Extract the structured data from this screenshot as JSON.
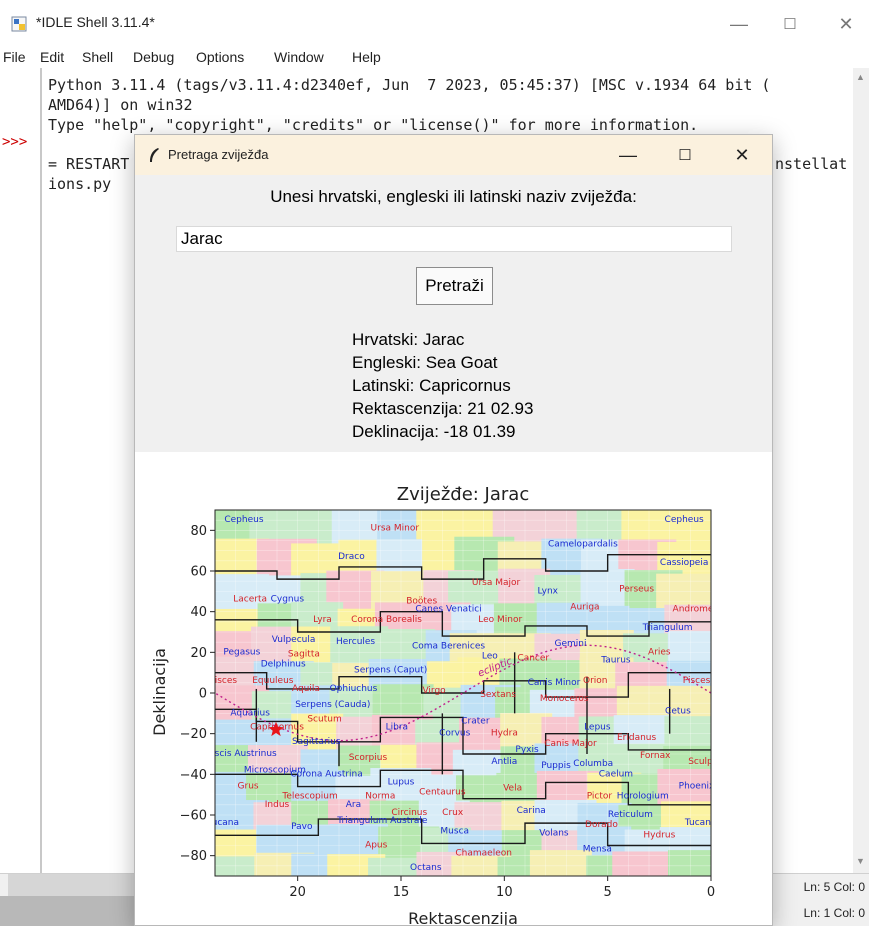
{
  "idle": {
    "title": "*IDLE Shell 3.11.4*",
    "window_controls": {
      "minimize": "—",
      "maximize": "☐",
      "close": "✕"
    },
    "menu": [
      "File",
      "Edit",
      "Shell",
      "Debug",
      "Options",
      "Window",
      "Help"
    ],
    "prompt": ">>>",
    "lines": [
      "Python 3.11.4 (tags/v3.11.4:d2340ef, Jun  7 2023, 05:45:37) [MSC v.1934 64 bit (",
      "AMD64)] on win32",
      "Type \"help\", \"copyright\", \"credits\" or \"license()\" for more information.",
      "",
      "= RESTART",
      "ions.py"
    ],
    "restart_tail": "nstellat",
    "status": {
      "top": "Ln: 5  Col: 0",
      "bottom": "Ln: 1  Col: 0"
    }
  },
  "dialog": {
    "title": "Pretraga zviježđa",
    "controls": {
      "minimize": "—",
      "maximize": "☐",
      "close": "✕"
    },
    "prompt_label": "Unesi hrvatski, engleski ili latinski naziv zviježđa:",
    "search": {
      "value": "Jarac",
      "placeholder": ""
    },
    "search_button": "Pretraži",
    "result": {
      "hr": "Hrvatski: Jarac",
      "en": "Engleski: Sea Goat",
      "la": "Latinski: Capricornus",
      "ra": "Rektascenzija: 21 02.93",
      "dec": "Deklinacija: -18 01.39"
    }
  },
  "chart_data": {
    "type": "scatter",
    "title": "Zviježđe: Jarac",
    "xlabel": "Rektascenzija",
    "ylabel": "Deklinacija",
    "xlim": [
      24,
      0
    ],
    "ylim": [
      -90,
      90
    ],
    "xticks": [
      20,
      15,
      10,
      5,
      0
    ],
    "yticks": [
      80,
      60,
      40,
      20,
      0,
      -20,
      -40,
      -60,
      -80
    ],
    "grid": true,
    "highlight": {
      "name": "Capricornus",
      "x": 21.05,
      "y": -18.02,
      "color": "#e8151b",
      "marker": "star"
    },
    "ecliptic_label": "ecliptic",
    "constellations": [
      {
        "name": "Cepheus",
        "x": 22.6,
        "y": 84,
        "color": "blue"
      },
      {
        "name": "Cepheus",
        "x": 1.3,
        "y": 84,
        "color": "blue"
      },
      {
        "name": "Ursa Minor",
        "x": 15.3,
        "y": 80,
        "color": "red"
      },
      {
        "name": "Draco",
        "x": 17.4,
        "y": 66,
        "color": "blue"
      },
      {
        "name": "Camelopardalis",
        "x": 6.2,
        "y": 72,
        "color": "blue"
      },
      {
        "name": "Cassiopeia",
        "x": 1.3,
        "y": 63,
        "color": "blue"
      },
      {
        "name": "Ursa Major",
        "x": 10.4,
        "y": 53,
        "color": "red"
      },
      {
        "name": "Lacerta",
        "x": 22.3,
        "y": 45,
        "color": "red"
      },
      {
        "name": "Cygnus",
        "x": 20.5,
        "y": 45,
        "color": "blue"
      },
      {
        "name": "Boötes",
        "x": 14.0,
        "y": 44,
        "color": "red"
      },
      {
        "name": "Canes Venatici",
        "x": 12.7,
        "y": 40,
        "color": "blue"
      },
      {
        "name": "Lynx",
        "x": 7.9,
        "y": 49,
        "color": "blue"
      },
      {
        "name": "Perseus",
        "x": 3.6,
        "y": 50,
        "color": "red"
      },
      {
        "name": "Auriga",
        "x": 6.1,
        "y": 41,
        "color": "red"
      },
      {
        "name": "Andromeda",
        "x": 0.6,
        "y": 40,
        "color": "red"
      },
      {
        "name": "Lyra",
        "x": 18.8,
        "y": 35,
        "color": "red"
      },
      {
        "name": "Corona Borealis",
        "x": 15.7,
        "y": 35,
        "color": "red"
      },
      {
        "name": "Leo Minor",
        "x": 10.2,
        "y": 35,
        "color": "red"
      },
      {
        "name": "Triangulum",
        "x": 2.1,
        "y": 31,
        "color": "blue"
      },
      {
        "name": "Vulpecula",
        "x": 20.2,
        "y": 25,
        "color": "blue"
      },
      {
        "name": "Hercules",
        "x": 17.2,
        "y": 24,
        "color": "blue"
      },
      {
        "name": "Coma Berenices",
        "x": 12.7,
        "y": 22,
        "color": "blue"
      },
      {
        "name": "Gemini",
        "x": 6.8,
        "y": 23,
        "color": "blue"
      },
      {
        "name": "Pegasus",
        "x": 22.7,
        "y": 19,
        "color": "blue"
      },
      {
        "name": "Sagitta",
        "x": 19.7,
        "y": 18,
        "color": "red"
      },
      {
        "name": "Aries",
        "x": 2.5,
        "y": 19,
        "color": "red"
      },
      {
        "name": "Delphinus",
        "x": 20.7,
        "y": 13,
        "color": "blue"
      },
      {
        "name": "Serpens (Caput)",
        "x": 15.5,
        "y": 10,
        "color": "blue"
      },
      {
        "name": "Leo",
        "x": 10.7,
        "y": 17,
        "color": "blue"
      },
      {
        "name": "Cancer",
        "x": 8.6,
        "y": 16,
        "color": "red"
      },
      {
        "name": "Taurus",
        "x": 4.6,
        "y": 15,
        "color": "blue"
      },
      {
        "name": "Pisces",
        "x": 23.6,
        "y": 5,
        "color": "red"
      },
      {
        "name": "Equuleus",
        "x": 21.2,
        "y": 5,
        "color": "red"
      },
      {
        "name": "Aquila",
        "x": 19.6,
        "y": 1,
        "color": "red"
      },
      {
        "name": "Ophiuchus",
        "x": 17.3,
        "y": 1,
        "color": "blue"
      },
      {
        "name": "Canis Minor",
        "x": 7.6,
        "y": 4,
        "color": "blue"
      },
      {
        "name": "Orion",
        "x": 5.6,
        "y": 5,
        "color": "red"
      },
      {
        "name": "Pisces",
        "x": 0.7,
        "y": 5,
        "color": "red"
      },
      {
        "name": "Virgo",
        "x": 13.4,
        "y": 0,
        "color": "red"
      },
      {
        "name": "Sextans",
        "x": 10.3,
        "y": -2,
        "color": "red"
      },
      {
        "name": "Serpens (Cauda)",
        "x": 18.3,
        "y": -7,
        "color": "blue"
      },
      {
        "name": "Aquarius",
        "x": 22.3,
        "y": -11,
        "color": "blue"
      },
      {
        "name": "Monoceros",
        "x": 7.1,
        "y": -4,
        "color": "red"
      },
      {
        "name": "Cetus",
        "x": 1.6,
        "y": -10,
        "color": "blue"
      },
      {
        "name": "Scutum",
        "x": 18.7,
        "y": -14,
        "color": "red"
      },
      {
        "name": "Libra",
        "x": 15.2,
        "y": -18,
        "color": "blue"
      },
      {
        "name": "Capricornus",
        "x": 21.0,
        "y": -18,
        "color": "red"
      },
      {
        "name": "Crater",
        "x": 11.4,
        "y": -15,
        "color": "blue"
      },
      {
        "name": "Lepus",
        "x": 5.5,
        "y": -18,
        "color": "blue"
      },
      {
        "name": "Corvus",
        "x": 12.4,
        "y": -21,
        "color": "blue"
      },
      {
        "name": "Hydra",
        "x": 10.0,
        "y": -21,
        "color": "red"
      },
      {
        "name": "Eridanus",
        "x": 3.6,
        "y": -23,
        "color": "red"
      },
      {
        "name": "Sagittarius",
        "x": 19.1,
        "y": -25,
        "color": "blue"
      },
      {
        "name": "Canis Major",
        "x": 6.8,
        "y": -26,
        "color": "red"
      },
      {
        "name": "Pyxis",
        "x": 8.9,
        "y": -29,
        "color": "blue"
      },
      {
        "name": "Piscis Austrinus",
        "x": 22.7,
        "y": -31,
        "color": "blue"
      },
      {
        "name": "Scorpius",
        "x": 16.6,
        "y": -33,
        "color": "red"
      },
      {
        "name": "Antlia",
        "x": 10.0,
        "y": -35,
        "color": "blue"
      },
      {
        "name": "Puppis",
        "x": 7.5,
        "y": -37,
        "color": "blue"
      },
      {
        "name": "Columba",
        "x": 5.7,
        "y": -36,
        "color": "blue"
      },
      {
        "name": "Fornax",
        "x": 2.7,
        "y": -32,
        "color": "red"
      },
      {
        "name": "Sculptor",
        "x": 0.2,
        "y": -35,
        "color": "red"
      },
      {
        "name": "Microscopium",
        "x": 21.1,
        "y": -39,
        "color": "blue"
      },
      {
        "name": "Corona Austrina",
        "x": 18.6,
        "y": -41,
        "color": "blue"
      },
      {
        "name": "Caelum",
        "x": 4.6,
        "y": -41,
        "color": "blue"
      },
      {
        "name": "Lupus",
        "x": 15.0,
        "y": -45,
        "color": "blue"
      },
      {
        "name": "Grus",
        "x": 22.4,
        "y": -47,
        "color": "red"
      },
      {
        "name": "Centaurus",
        "x": 13.0,
        "y": -50,
        "color": "red"
      },
      {
        "name": "Vela",
        "x": 9.6,
        "y": -48,
        "color": "red"
      },
      {
        "name": "Phoenix",
        "x": 0.7,
        "y": -47,
        "color": "blue"
      },
      {
        "name": "Telescopium",
        "x": 19.4,
        "y": -52,
        "color": "red"
      },
      {
        "name": "Norma",
        "x": 16.0,
        "y": -52,
        "color": "red"
      },
      {
        "name": "Pictor",
        "x": 5.4,
        "y": -52,
        "color": "red"
      },
      {
        "name": "Horologium",
        "x": 3.3,
        "y": -52,
        "color": "blue"
      },
      {
        "name": "Indus",
        "x": 21.0,
        "y": -56,
        "color": "red"
      },
      {
        "name": "Ara",
        "x": 17.3,
        "y": -56,
        "color": "blue"
      },
      {
        "name": "Circinus",
        "x": 14.6,
        "y": -60,
        "color": "red"
      },
      {
        "name": "Crux",
        "x": 12.5,
        "y": -60,
        "color": "red"
      },
      {
        "name": "Carina",
        "x": 8.7,
        "y": -59,
        "color": "blue"
      },
      {
        "name": "Reticulum",
        "x": 3.9,
        "y": -61,
        "color": "blue"
      },
      {
        "name": "Triangulum Australe",
        "x": 15.9,
        "y": -64,
        "color": "blue"
      },
      {
        "name": "Tucana",
        "x": 23.6,
        "y": -65,
        "color": "blue"
      },
      {
        "name": "Pavo",
        "x": 19.8,
        "y": -67,
        "color": "blue"
      },
      {
        "name": "Musca",
        "x": 12.4,
        "y": -69,
        "color": "blue"
      },
      {
        "name": "Volans",
        "x": 7.6,
        "y": -70,
        "color": "blue"
      },
      {
        "name": "Dorado",
        "x": 5.3,
        "y": -66,
        "color": "red"
      },
      {
        "name": "Tucana",
        "x": 0.5,
        "y": -65,
        "color": "blue"
      },
      {
        "name": "Hydrus",
        "x": 2.5,
        "y": -71,
        "color": "red"
      },
      {
        "name": "Apus",
        "x": 16.2,
        "y": -76,
        "color": "red"
      },
      {
        "name": "Chamaeleon",
        "x": 11.0,
        "y": -80,
        "color": "red"
      },
      {
        "name": "Mensa",
        "x": 5.5,
        "y": -78,
        "color": "blue"
      },
      {
        "name": "Octans",
        "x": 13.8,
        "y": -87,
        "color": "blue"
      }
    ]
  }
}
